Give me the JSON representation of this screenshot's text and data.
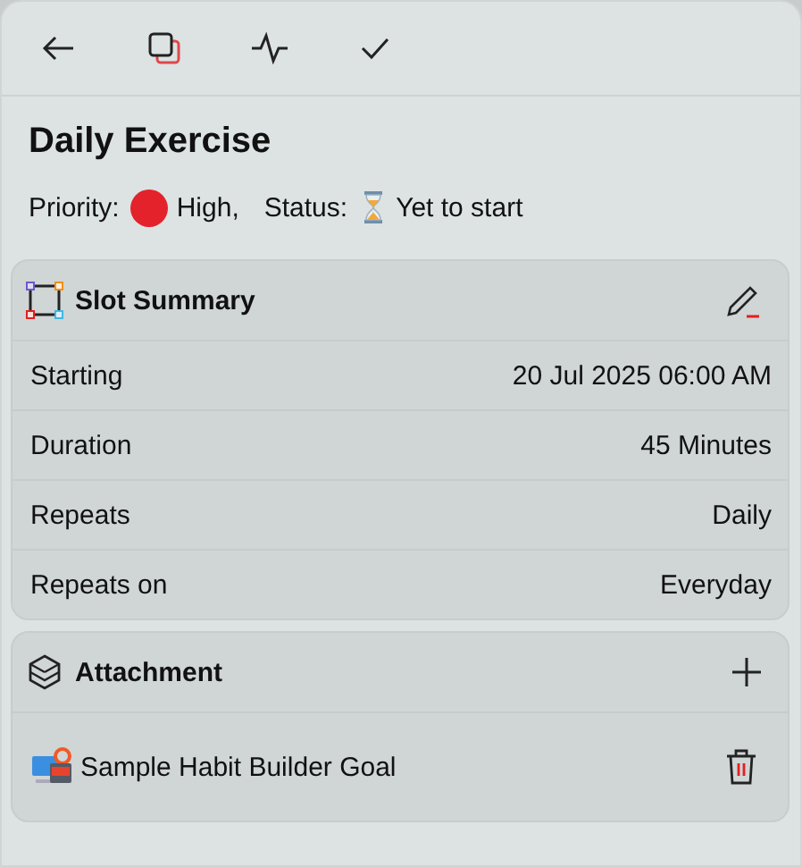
{
  "title": "Daily Exercise",
  "priority": {
    "label": "Priority:",
    "value": "High,",
    "color": "#e3222b"
  },
  "status": {
    "label": "Status:",
    "value": "Yet to start"
  },
  "slot_summary": {
    "title": "Slot Summary",
    "rows": [
      {
        "label": "Starting",
        "value": "20 Jul 2025 06:00 AM"
      },
      {
        "label": "Duration",
        "value": "45 Minutes"
      },
      {
        "label": "Repeats",
        "value": "Daily"
      },
      {
        "label": "Repeats on",
        "value": "Everyday"
      }
    ]
  },
  "attachment": {
    "title": "Attachment",
    "items": [
      {
        "name": "Sample Habit Builder Goal"
      }
    ]
  }
}
